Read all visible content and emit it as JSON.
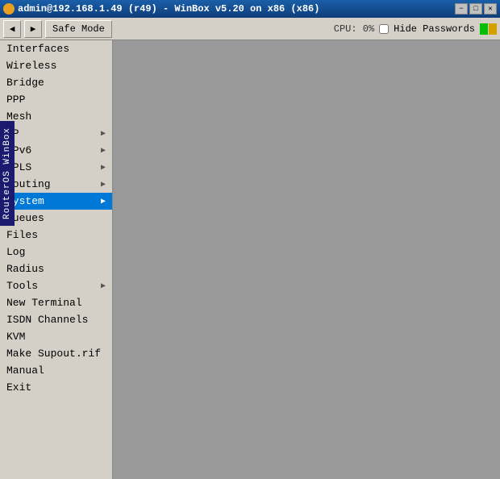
{
  "titlebar": {
    "title": "admin@192.168.1.49 (r49) - WinBox v5.20 on x86 (x86)",
    "minimize": "−",
    "maximize": "□",
    "close": "✕"
  },
  "toolbar": {
    "back_label": "◀",
    "forward_label": "▶",
    "safe_mode_label": "Safe Mode",
    "cpu_label": "CPU: 0%",
    "hide_passwords_label": "Hide Passwords"
  },
  "sidebar": {
    "items": [
      {
        "id": "interfaces",
        "label": "Interfaces",
        "arrow": false
      },
      {
        "id": "wireless",
        "label": "Wireless",
        "arrow": false
      },
      {
        "id": "bridge",
        "label": "Bridge",
        "arrow": false
      },
      {
        "id": "ppp",
        "label": "PPP",
        "arrow": false
      },
      {
        "id": "mesh",
        "label": "Mesh",
        "arrow": false
      },
      {
        "id": "ip",
        "label": "IP",
        "arrow": true
      },
      {
        "id": "ipv6",
        "label": "IPv6",
        "arrow": true
      },
      {
        "id": "mpls",
        "label": "MPLS",
        "arrow": true
      },
      {
        "id": "routing",
        "label": "Routing",
        "arrow": true
      },
      {
        "id": "system",
        "label": "System",
        "arrow": true,
        "active": true
      },
      {
        "id": "queues",
        "label": "Queues",
        "arrow": false
      },
      {
        "id": "files",
        "label": "Files",
        "arrow": false
      },
      {
        "id": "log",
        "label": "Log",
        "arrow": false
      },
      {
        "id": "radius",
        "label": "Radius",
        "arrow": false
      },
      {
        "id": "tools",
        "label": "Tools",
        "arrow": true
      },
      {
        "id": "new-terminal",
        "label": "New Terminal",
        "arrow": false
      },
      {
        "id": "isdn-channels",
        "label": "ISDN Channels",
        "arrow": false
      },
      {
        "id": "kvm",
        "label": "KVM",
        "arrow": false
      },
      {
        "id": "make-supout",
        "label": "Make Supout.rif",
        "arrow": false
      },
      {
        "id": "manual",
        "label": "Manual",
        "arrow": false
      },
      {
        "id": "exit",
        "label": "Exit",
        "arrow": false
      }
    ]
  },
  "side_label": "RouterOS WinBox"
}
